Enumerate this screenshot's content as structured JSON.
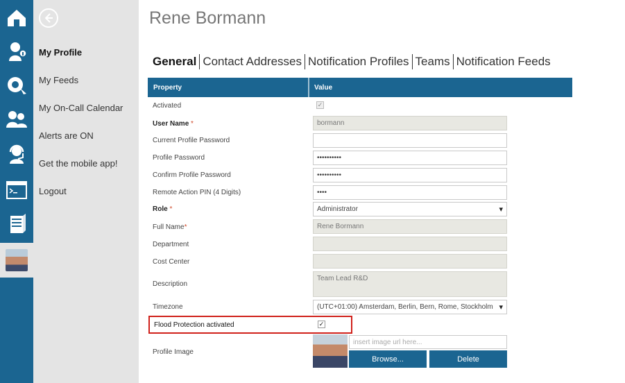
{
  "colors": {
    "rail": "#1b6591",
    "panel": "#e4e4e4",
    "highlight_border": "#d0201a"
  },
  "nav": {
    "menu": [
      {
        "label": "My Profile",
        "active": true
      },
      {
        "label": "My Feeds"
      },
      {
        "label": "My On-Call Calendar"
      },
      {
        "label": "Alerts are ON"
      },
      {
        "label": "Get the mobile app!"
      },
      {
        "label": "Logout"
      }
    ]
  },
  "rail_icons": [
    "home-icon",
    "person-info-icon",
    "alert-icon",
    "team-icon",
    "headset-icon",
    "console-icon",
    "server-icon"
  ],
  "page": {
    "title": "Rene Bormann"
  },
  "tabs": [
    "General",
    "Contact Addresses",
    "Notification Profiles",
    "Teams",
    "Notification Feeds"
  ],
  "table": {
    "col_property": "Property",
    "col_value": "Value"
  },
  "fields": {
    "activated": {
      "label": "Activated",
      "checked": true
    },
    "user_name": {
      "label": "User Name",
      "value": "bormann"
    },
    "current_password": {
      "label": "Current Profile Password",
      "value": ""
    },
    "profile_password": {
      "label": "Profile Password",
      "value": "••••••••••"
    },
    "confirm_password": {
      "label": "Confirm Profile Password",
      "value": "••••••••••"
    },
    "remote_pin": {
      "label": "Remote Action PIN (4 Digits)",
      "value": "••••"
    },
    "role": {
      "label": "Role",
      "value": "Administrator"
    },
    "full_name": {
      "label": "Full Name",
      "value": "Rene Bormann"
    },
    "department": {
      "label": "Department",
      "value": ""
    },
    "cost_center": {
      "label": "Cost Center",
      "value": ""
    },
    "description": {
      "label": "Description",
      "value": "Team Lead R&D"
    },
    "timezone": {
      "label": "Timezone",
      "value": "(UTC+01:00) Amsterdam, Berlin, Bern, Rome, Stockholm"
    },
    "flood_protection": {
      "label": "Flood Protection activated",
      "checked": true
    },
    "profile_image": {
      "label": "Profile Image",
      "placeholder": "insert image url here...",
      "browse_label": "Browse...",
      "delete_label": "Delete"
    }
  }
}
